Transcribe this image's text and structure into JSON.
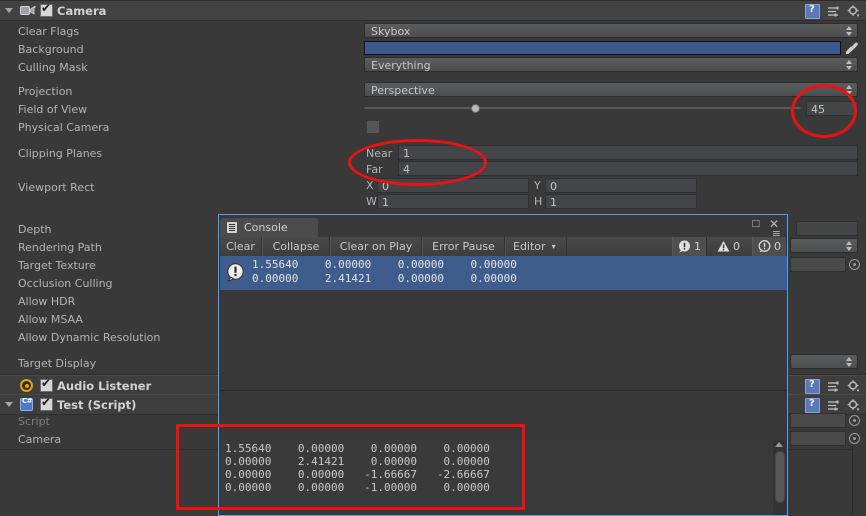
{
  "inspector": {
    "components": [
      {
        "name": "Camera",
        "icon": "camera-icon",
        "enabled": true,
        "expanded": true
      }
    ],
    "camera_properties": [
      {
        "label": "Clear Flags",
        "type": "popup",
        "value": "Skybox"
      },
      {
        "label": "Background",
        "type": "color",
        "value": "#3d5a8c"
      },
      {
        "label": "Culling Mask",
        "type": "popup",
        "value": "Everything"
      },
      {
        "label": "Projection",
        "type": "popup",
        "value": "Perspective"
      },
      {
        "label": "Field of View",
        "type": "slider",
        "value": "45"
      },
      {
        "label": "Physical Camera",
        "type": "toggle",
        "value": false
      },
      {
        "label": "Clipping Planes",
        "type": "pair",
        "value": ""
      },
      {
        "label": "Viewport Rect",
        "type": "rect",
        "value": ""
      },
      {
        "label": "Depth",
        "type": "number",
        "value": ""
      },
      {
        "label": "Rendering Path",
        "type": "popup",
        "value": ""
      },
      {
        "label": "Target Texture",
        "type": "object",
        "value": ""
      },
      {
        "label": "Occlusion Culling",
        "type": "toggle",
        "value": ""
      },
      {
        "label": "Allow HDR",
        "type": "toggle",
        "value": ""
      },
      {
        "label": "Allow MSAA",
        "type": "toggle",
        "value": ""
      },
      {
        "label": "Allow Dynamic Resolution",
        "type": "toggle",
        "value": ""
      },
      {
        "label": "Target Display",
        "type": "popup",
        "value": ""
      }
    ],
    "clipping": {
      "near_label": "Near",
      "near_value": "1",
      "far_label": "Far",
      "far_value": "4"
    },
    "viewport": {
      "x_label": "X",
      "x_value": "0",
      "y_label": "Y",
      "y_value": "0",
      "w_label": "W",
      "w_value": "1",
      "h_label": "H",
      "h_value": "1"
    },
    "fov_value": "45",
    "audio_listener": {
      "name": "Audio Listener",
      "enabled": true
    },
    "test_script": {
      "name": "Test (Script)",
      "enabled": true,
      "expanded": true
    },
    "script_row": {
      "label": "Script",
      "value": ""
    },
    "camera_row": {
      "label": "Camera",
      "value": ""
    },
    "icons": {
      "help": "help-icon",
      "preset": "preset-icon",
      "gear": "gear-icon",
      "eyedropper": "eyedropper-icon"
    }
  },
  "console": {
    "title": "Console",
    "tab_icon": "console-icon",
    "window_buttons": {
      "maximize": "□",
      "close": "✕",
      "menu": "≡"
    },
    "toolbar": {
      "clear": "Clear",
      "collapse": "Collapse",
      "clear_on_play": "Clear on Play",
      "error_pause": "Error Pause",
      "editor": "Editor",
      "editor_caret": "▾"
    },
    "counters": {
      "error_count": "1",
      "warning_count": "0",
      "info_count": "0"
    },
    "messages": [
      {
        "type": "error",
        "icon": "error-icon",
        "selected": true,
        "line1": "1.55640    0.00000    0.00000    0.00000",
        "line2": "0.00000    2.41421    0.00000    0.00000"
      }
    ],
    "detail": {
      "line1": "1.55640    0.00000    0.00000    0.00000",
      "line2": "0.00000    2.41421    0.00000    0.00000",
      "line3": "0.00000    0.00000   -1.66667   -2.66667",
      "line4": "0.00000    0.00000   -1.00000    0.00000"
    }
  },
  "annotations": {
    "fov_circle": "highlight-field-of-view",
    "clipping_circle": "highlight-clipping-planes",
    "matrix_rect": "highlight-matrix-output",
    "color": "#ee1111"
  }
}
